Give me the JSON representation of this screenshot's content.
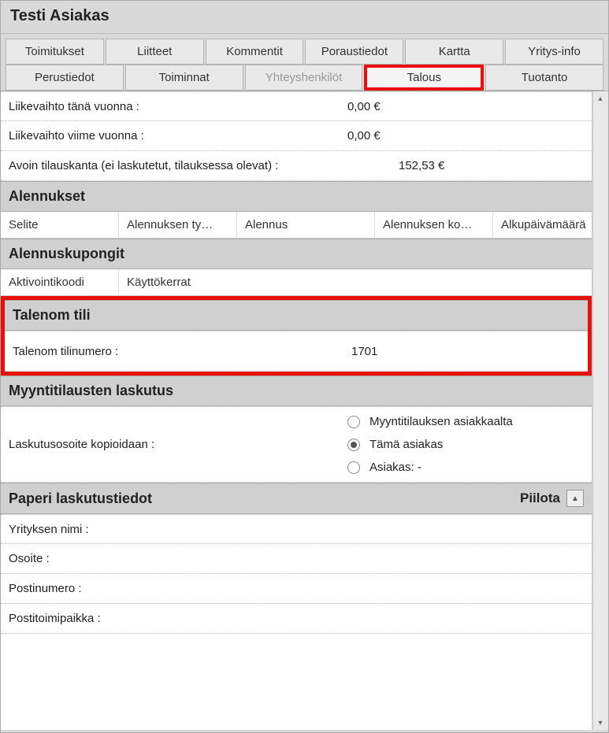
{
  "title": "Testi Asiakas",
  "tabs_row1": [
    {
      "label": "Toimitukset"
    },
    {
      "label": "Liitteet"
    },
    {
      "label": "Kommentit"
    },
    {
      "label": "Poraustiedot"
    },
    {
      "label": "Kartta"
    },
    {
      "label": "Yritys-info"
    }
  ],
  "tabs_row2": [
    {
      "label": "Perustiedot"
    },
    {
      "label": "Toiminnat"
    },
    {
      "label": "Yhteyshenkilöt"
    },
    {
      "label": "Talous"
    },
    {
      "label": "Tuotanto"
    }
  ],
  "turnover_this_label": "Liikevaihto tänä vuonna :",
  "turnover_this_value": "0,00 €",
  "turnover_last_label": "Liikevaihto viime vuonna :",
  "turnover_last_value": "0,00 €",
  "open_orders_label": "Avoin tilauskanta (ei laskutetut, tilauksessa olevat) :",
  "open_orders_value": "152,53 €",
  "alennukset_header": "Alennukset",
  "alennukset_cols": [
    "Selite",
    "Alennuksen ty…",
    "Alennus",
    "Alennuksen ko…",
    "Alkupäivämäärä"
  ],
  "kupongit_header": "Alennuskupongit",
  "kupongit_cols": [
    "Aktivointikoodi",
    "Käyttökerrat"
  ],
  "talenom_header": "Talenom tili",
  "talenom_label": "Talenom tilinumero :",
  "talenom_value": "1701",
  "myynti_header": "Myyntitilausten laskutus",
  "laskutus_label": "Laskutusosoite kopioidaan :",
  "radio_opts": [
    {
      "label": "Myyntitilauksen asiakkaalta",
      "selected": false
    },
    {
      "label": "Tämä asiakas",
      "selected": true
    },
    {
      "label": "Asiakas: -",
      "selected": false
    }
  ],
  "paperi_header": "Paperi laskutustiedot",
  "piilota_label": "Piilota",
  "paperi_fields": {
    "yritys_label": "Yrityksen nimi :",
    "osoite_label": "Osoite :",
    "postinumero_label": "Postinumero :",
    "postitoimipaikka_label": "Postitoimipaikka :"
  }
}
